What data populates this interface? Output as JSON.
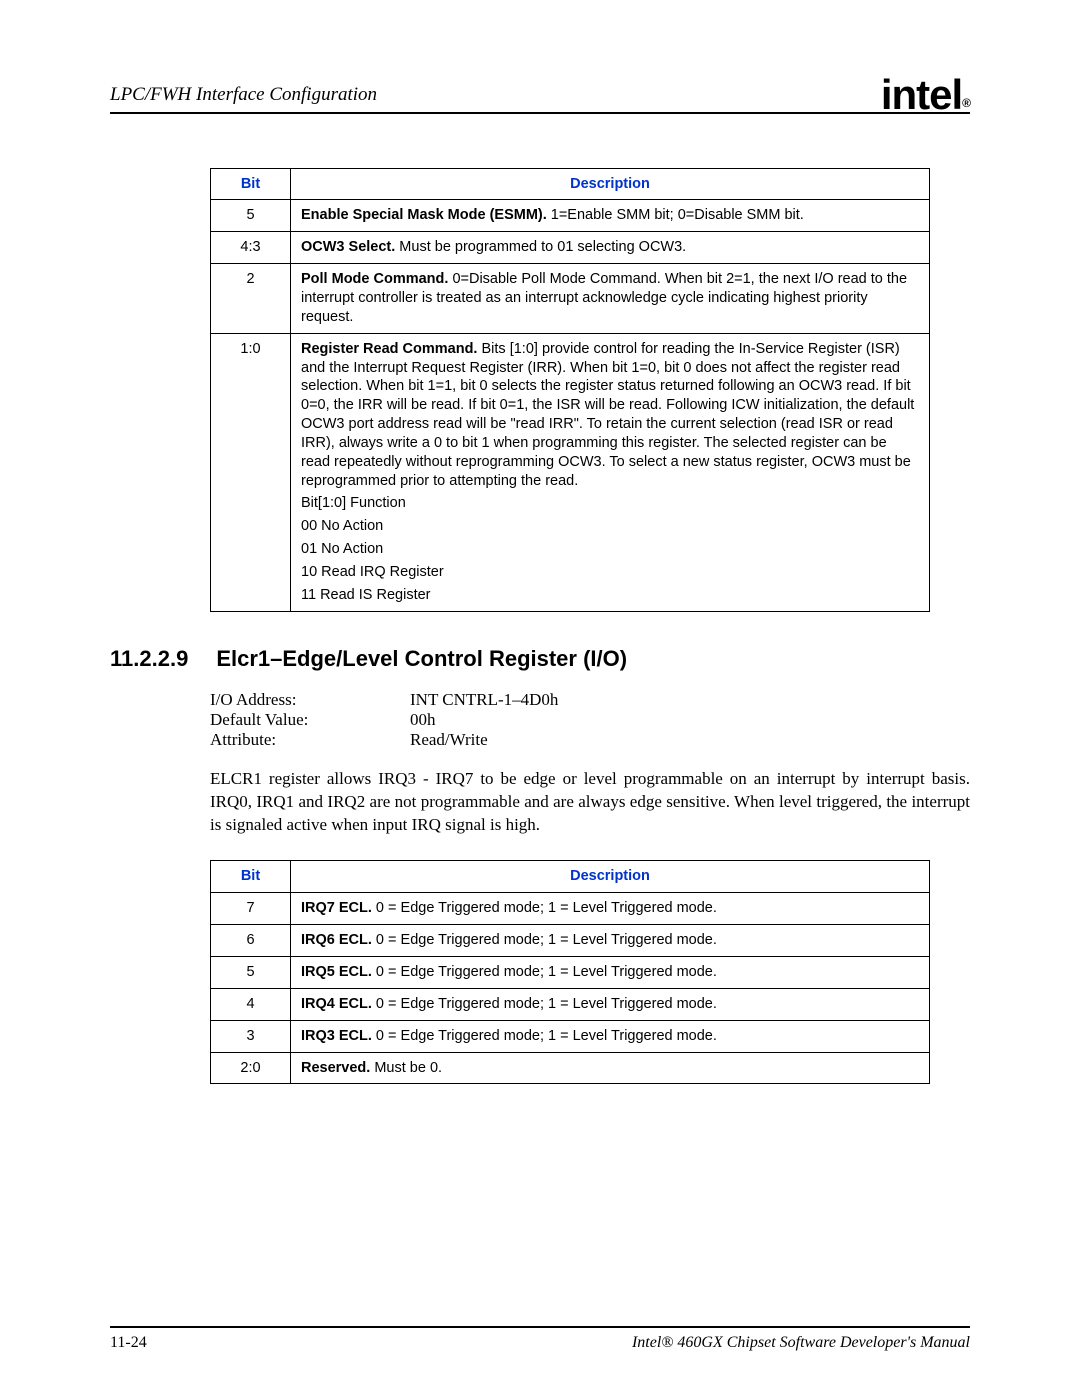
{
  "header": {
    "title": "LPC/FWH Interface Configuration",
    "logo_text": "intel",
    "logo_mark": "®"
  },
  "table1": {
    "headers": {
      "bit": "Bit",
      "desc": "Description"
    },
    "rows": [
      {
        "bit": "5",
        "bold": "Enable Special Mask Mode (ESMM).",
        "rest": " 1=Enable SMM bit; 0=Disable SMM bit."
      },
      {
        "bit": "4:3",
        "bold": "OCW3 Select.",
        "rest": " Must be programmed to 01 selecting OCW3."
      },
      {
        "bit": "2",
        "bold": "Poll Mode Command.",
        "rest": " 0=Disable Poll Mode Command. When bit 2=1, the next I/O read to the interrupt controller is treated as an interrupt acknowledge cycle indicating highest priority request."
      },
      {
        "bit": "1:0",
        "bold": "Register Read Command.",
        "rest": " Bits [1:0] provide control for reading the In-Service Register (ISR) and the Interrupt Request Register (IRR). When bit 1=0, bit 0 does not affect the register read selection. When bit 1=1, bit 0 selects the register status returned following an OCW3 read. If bit 0=0, the IRR will be read. If bit 0=1, the ISR will be read. Following ICW initialization, the default OCW3 port address read will be \"read IRR\". To retain the current selection (read ISR or read IRR), always write a 0 to bit 1 when programming this register. The selected register can be read repeatedly without reprogramming OCW3. To select a new status register, OCW3 must be reprogrammed prior to attempting the read.",
        "extras": [
          "Bit[1:0] Function",
          "00 No Action",
          "01 No Action",
          "10 Read IRQ Register",
          "11 Read IS Register"
        ]
      }
    ]
  },
  "section": {
    "num": "11.2.2.9",
    "title": "Elcr1–Edge/Level Control Register (I/O)"
  },
  "meta": {
    "rows": [
      {
        "label": "I/O Address:",
        "value": "INT CNTRL-1–4D0h"
      },
      {
        "label": "Default Value:",
        "value": "00h"
      },
      {
        "label": "Attribute:",
        "value": "Read/Write"
      }
    ]
  },
  "paragraph": "ELCR1 register allows IRQ3 - IRQ7 to be edge or level programmable on an interrupt by interrupt basis. IRQ0, IRQ1 and IRQ2 are not programmable and are always edge sensitive. When level triggered, the interrupt is signaled active when input IRQ signal is high.",
  "table2": {
    "headers": {
      "bit": "Bit",
      "desc": "Description"
    },
    "rows": [
      {
        "bit": "7",
        "bold": "IRQ7 ECL.",
        "rest": " 0 = Edge Triggered mode; 1 = Level Triggered mode."
      },
      {
        "bit": "6",
        "bold": "IRQ6 ECL.",
        "rest": " 0 = Edge Triggered mode; 1 = Level Triggered mode."
      },
      {
        "bit": "5",
        "bold": "IRQ5 ECL.",
        "rest": " 0 = Edge Triggered mode; 1 = Level Triggered mode."
      },
      {
        "bit": "4",
        "bold": "IRQ4 ECL.",
        "rest": " 0 = Edge Triggered mode; 1 = Level Triggered mode."
      },
      {
        "bit": "3",
        "bold": "IRQ3 ECL.",
        "rest": " 0 = Edge Triggered mode; 1 = Level Triggered mode."
      },
      {
        "bit": "2:0",
        "bold": "Reserved.",
        "rest": " Must be 0."
      }
    ]
  },
  "footer": {
    "left": "11-24",
    "right": "Intel® 460GX Chipset Software Developer's Manual"
  }
}
